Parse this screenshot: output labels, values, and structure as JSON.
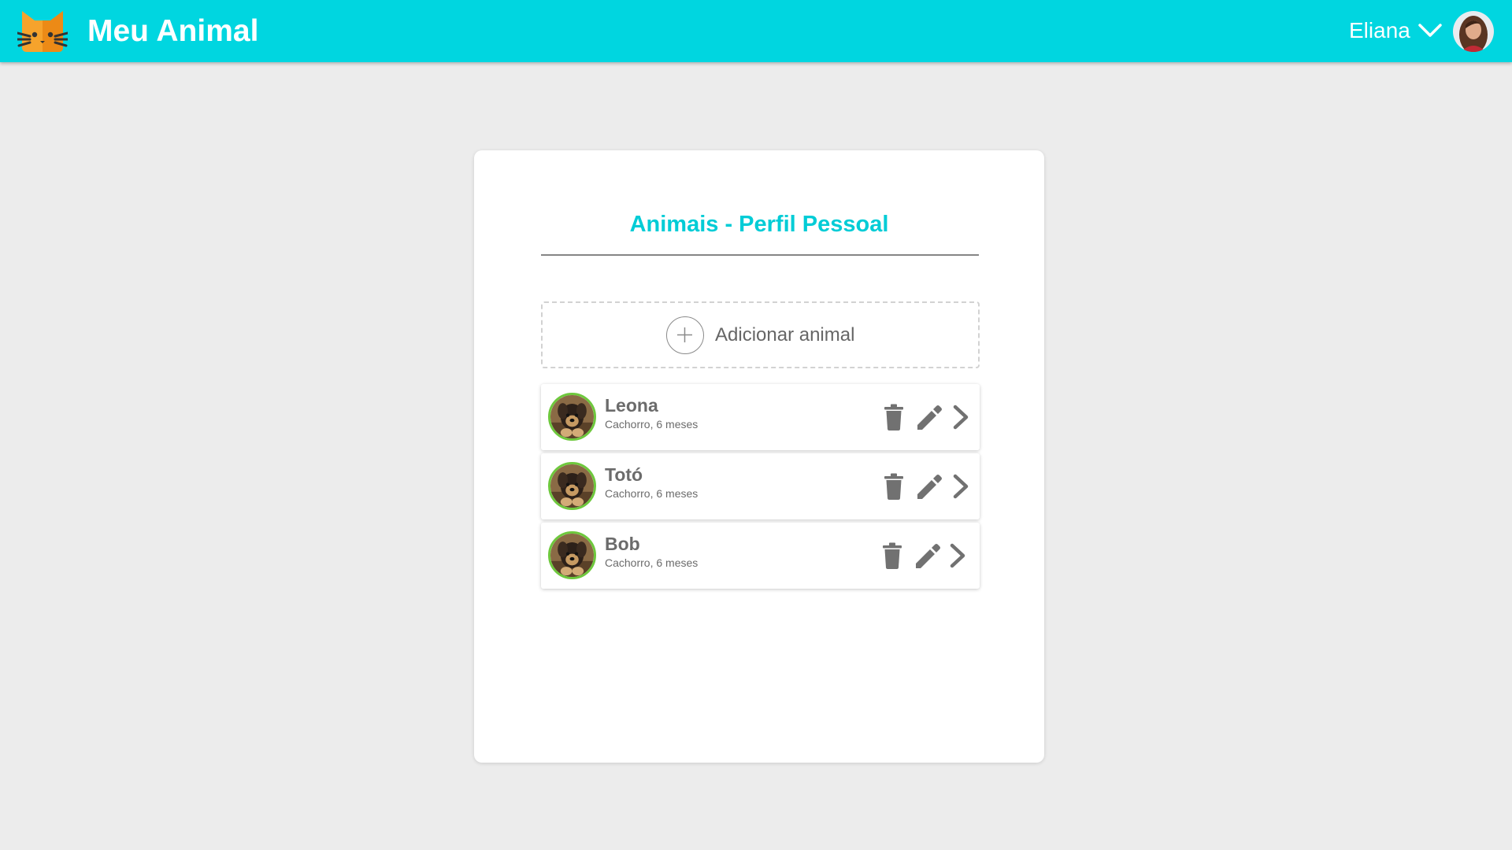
{
  "header": {
    "app_title": "Meu Animal",
    "user_name": "Eliana",
    "logo_icon": "cat-face-icon",
    "menu_icon": "chevron-down-icon",
    "brand_color": "#00d6e0"
  },
  "main": {
    "title": "Animais - Perfil Pessoal",
    "add_label": "Adicionar animal",
    "pets": [
      {
        "name": "Leona",
        "description": "Cachorro, 6 meses"
      },
      {
        "name": "Totó",
        "description": "Cachorro, 6 meses"
      },
      {
        "name": "Bob",
        "description": "Cachorro, 6 meses"
      }
    ]
  },
  "icons": {
    "delete": "trash-icon",
    "edit": "pencil-icon",
    "open": "chevron-right-icon",
    "add": "plus-circle-icon"
  },
  "colors": {
    "title_accent": "#00ccd6",
    "pet_avatar_ring": "#6ec83d",
    "icon_gray": "#717171"
  }
}
